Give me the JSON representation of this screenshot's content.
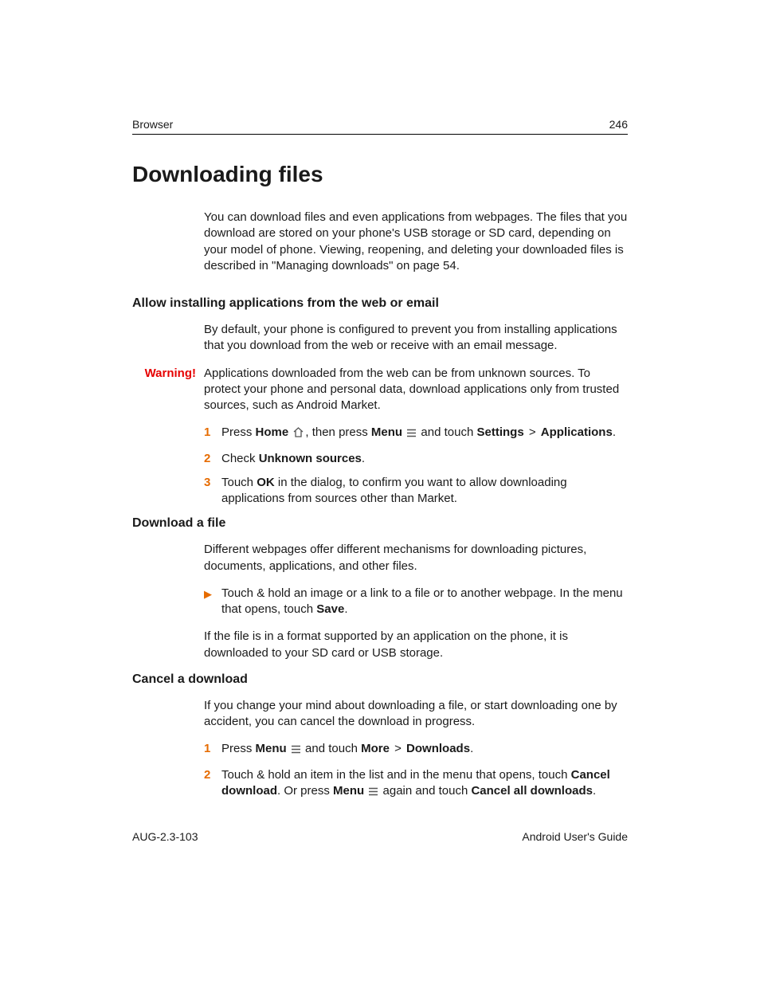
{
  "header": {
    "section": "Browser",
    "page_number": "246"
  },
  "title": "Downloading files",
  "intro": "You can download files and even applications from webpages. The files that you download are stored on your phone's USB storage or SD card, depending on your model of phone. Viewing, reopening, and deleting your downloaded files is described in \"Managing downloads\" on page 54.",
  "section1": {
    "heading": "Allow installing applications from the web or email",
    "body": "By default, your phone is configured to prevent you from installing applications that you download from the web or receive with an email message.",
    "warning_label": "Warning!",
    "warning": "Applications downloaded from the web can be from unknown sources. To protect your phone and personal data, download applications only from trusted sources, such as Android Market.",
    "step1": {
      "press": "Press ",
      "home": "Home",
      "then": ", then press ",
      "menu": "Menu",
      "touch": " and touch ",
      "settings": "Settings",
      "sep": " > ",
      "apps": "Applications",
      "end": "."
    },
    "step2": {
      "check": "Check ",
      "unknown": "Unknown sources",
      "end": "."
    },
    "step3": {
      "touch": "Touch ",
      "ok": "OK",
      "rest": " in the dialog, to confirm you want to allow downloading applications from sources other than Market."
    }
  },
  "section2": {
    "heading": "Download a file",
    "body": "Different webpages offer different mechanisms for downloading pictures, documents, applications, and other files.",
    "bullet": {
      "pre": "Touch & hold an image or a link to a file or to another webpage. In the menu that opens, touch ",
      "save": "Save",
      "end": "."
    },
    "after": "If the file is in a format supported by an application on the phone, it is downloaded to your SD card or USB storage."
  },
  "section3": {
    "heading": "Cancel a download",
    "body": "If you change your mind about downloading a file, or start downloading one by accident, you can cancel the download in progress.",
    "step1": {
      "press": "Press ",
      "menu": "Menu",
      "touch": " and touch ",
      "more": "More",
      "sep": " > ",
      "downloads": "Downloads",
      "end": "."
    },
    "step2": {
      "a": "Touch & hold an item in the list and in the menu that opens, touch ",
      "cancel": "Cancel download",
      "b": ". Or press ",
      "menu": "Menu",
      "c": " again and touch ",
      "cancelall": "Cancel all downloads",
      "end": "."
    }
  },
  "footer": {
    "left": "AUG-2.3-103",
    "right": "Android User's Guide"
  }
}
